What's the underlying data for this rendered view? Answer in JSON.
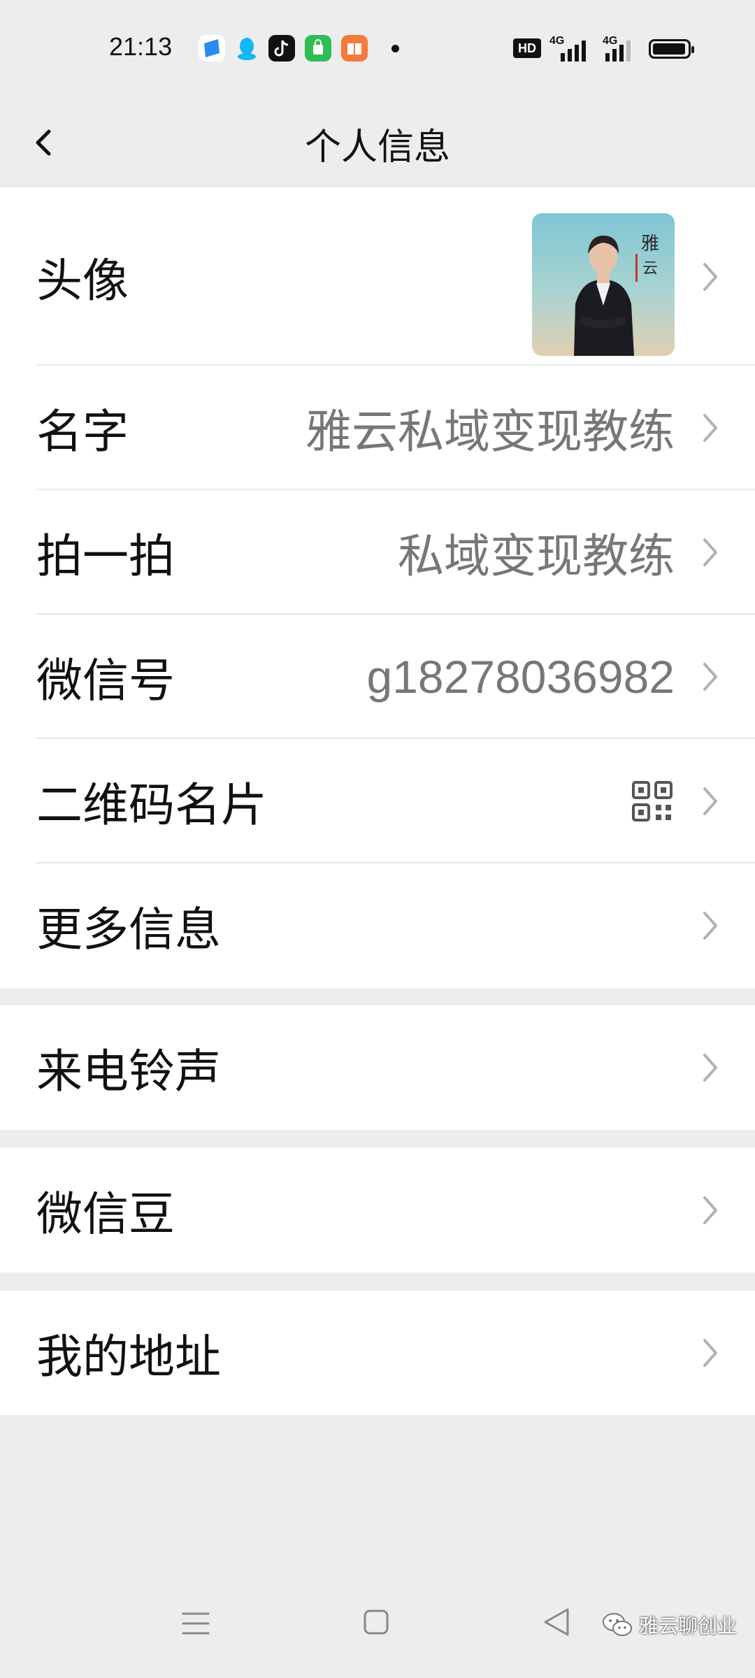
{
  "status_bar": {
    "time": "21:13",
    "hd_label": "HD",
    "network_1": "4G",
    "network_2": "4G",
    "notification_icons": [
      "blue-app-icon",
      "qq-icon",
      "tiktok-icon",
      "shopping-bag-icon",
      "book-icon"
    ],
    "battery_level": 0.85
  },
  "header": {
    "title": "个人信息",
    "back_icon": "chevron-left-icon"
  },
  "profile": {
    "avatar_label": "头像",
    "name_label": "名字",
    "name_value": "雅云私域变现教练",
    "pat_label": "拍一拍",
    "pat_value": "私域变现教练",
    "wechat_id_label": "微信号",
    "wechat_id_value": "g18278036982",
    "qr_label": "二维码名片",
    "more_label": "更多信息"
  },
  "ringtone": {
    "label": "来电铃声"
  },
  "beans": {
    "label": "微信豆"
  },
  "address": {
    "label": "我的地址"
  },
  "watermark": {
    "text": "雅云聊创业",
    "icon": "wechat-icon"
  },
  "colors": {
    "background": "#ededed",
    "card": "#ffffff",
    "label": "#111111",
    "value": "#777777"
  }
}
